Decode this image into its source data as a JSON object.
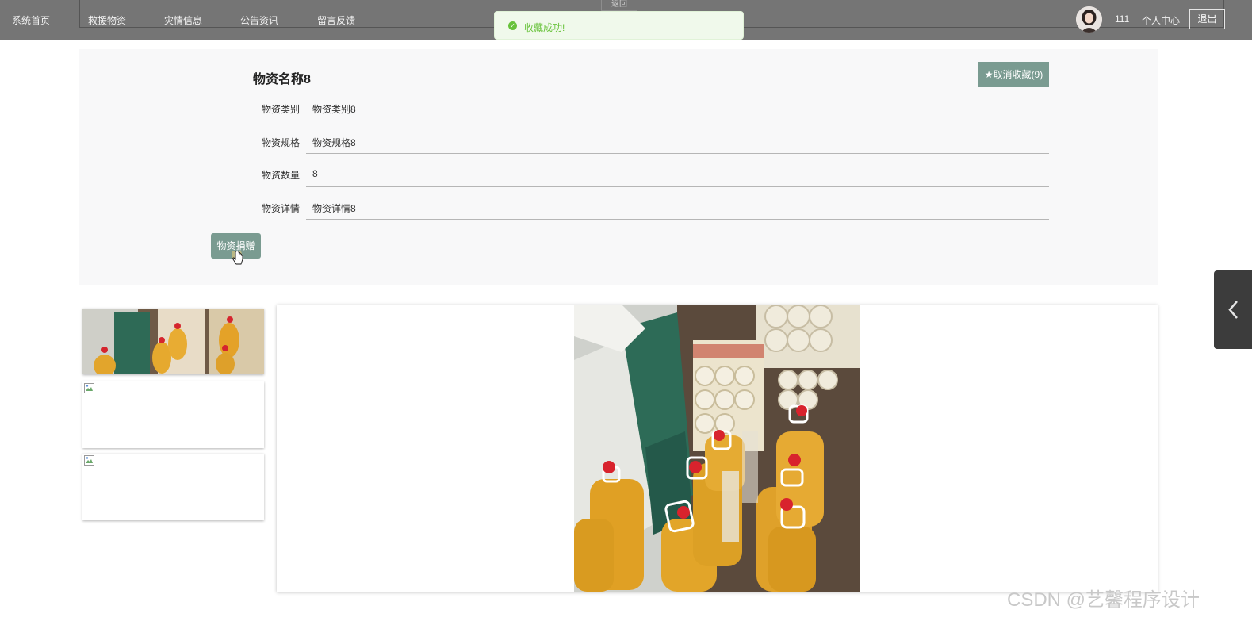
{
  "nav": {
    "items": [
      {
        "label": "系统首页"
      },
      {
        "label": "救援物资"
      },
      {
        "label": "灾情信息"
      },
      {
        "label": "公告资讯"
      },
      {
        "label": "留言反馈"
      }
    ],
    "back_label": "返回",
    "username": "111",
    "personal_center": "个人中心",
    "logout": "退出"
  },
  "toast": {
    "message": "收藏成功!",
    "color": "#67c23a"
  },
  "detail": {
    "title": "物资名称8",
    "unfavorite_button": "★取消收藏(9)",
    "fields": [
      {
        "label": "物资类别",
        "value": "物资类别8"
      },
      {
        "label": "物资规格",
        "value": "物资规格8"
      },
      {
        "label": "物资数量",
        "value": "8"
      },
      {
        "label": "物资详情",
        "value": "物资详情8"
      }
    ],
    "donate_button": "物资捐赠"
  },
  "colors": {
    "nav_bg": "#757575",
    "accent_button": "#7a9b91",
    "panel_bg": "#f8f8f9"
  },
  "watermark": "CSDN @艺馨程序设计"
}
